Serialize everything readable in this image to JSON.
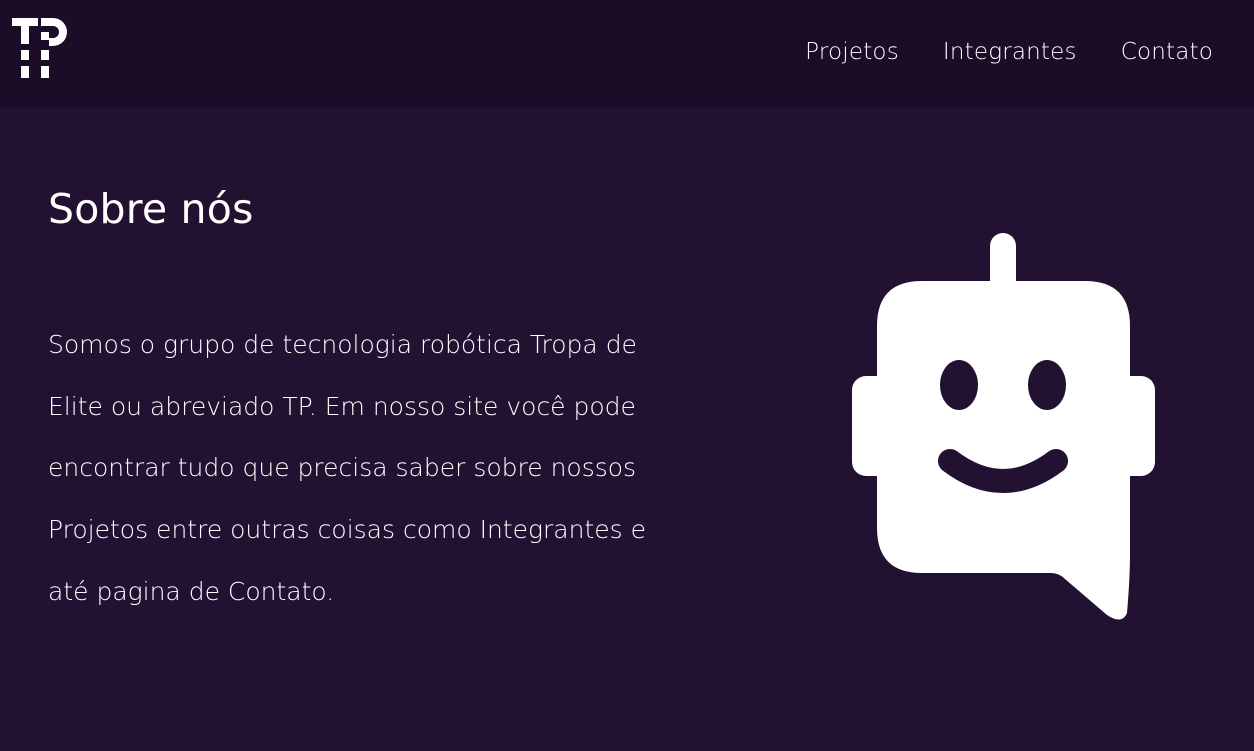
{
  "header": {
    "logo_text": "TP",
    "nav": [
      {
        "label": "Projetos"
      },
      {
        "label": "Integrantes"
      },
      {
        "label": "Contato"
      }
    ]
  },
  "about": {
    "title": "Sobre nós",
    "lines": [
      "Somos o grupo de tecnologia robótica Tropa de",
      "Elite ou abreviado TP. Em nosso site você pode",
      "encontrar tudo que precisa saber sobre nossos",
      "Projetos entre outras coisas como Integrantes e",
      "até pagina de Contato."
    ]
  },
  "illustration": {
    "icon": "robot-chat-icon"
  },
  "colors": {
    "header_bg": "#1b0c27",
    "page_bg": "#231131",
    "text": "#ffffff"
  }
}
